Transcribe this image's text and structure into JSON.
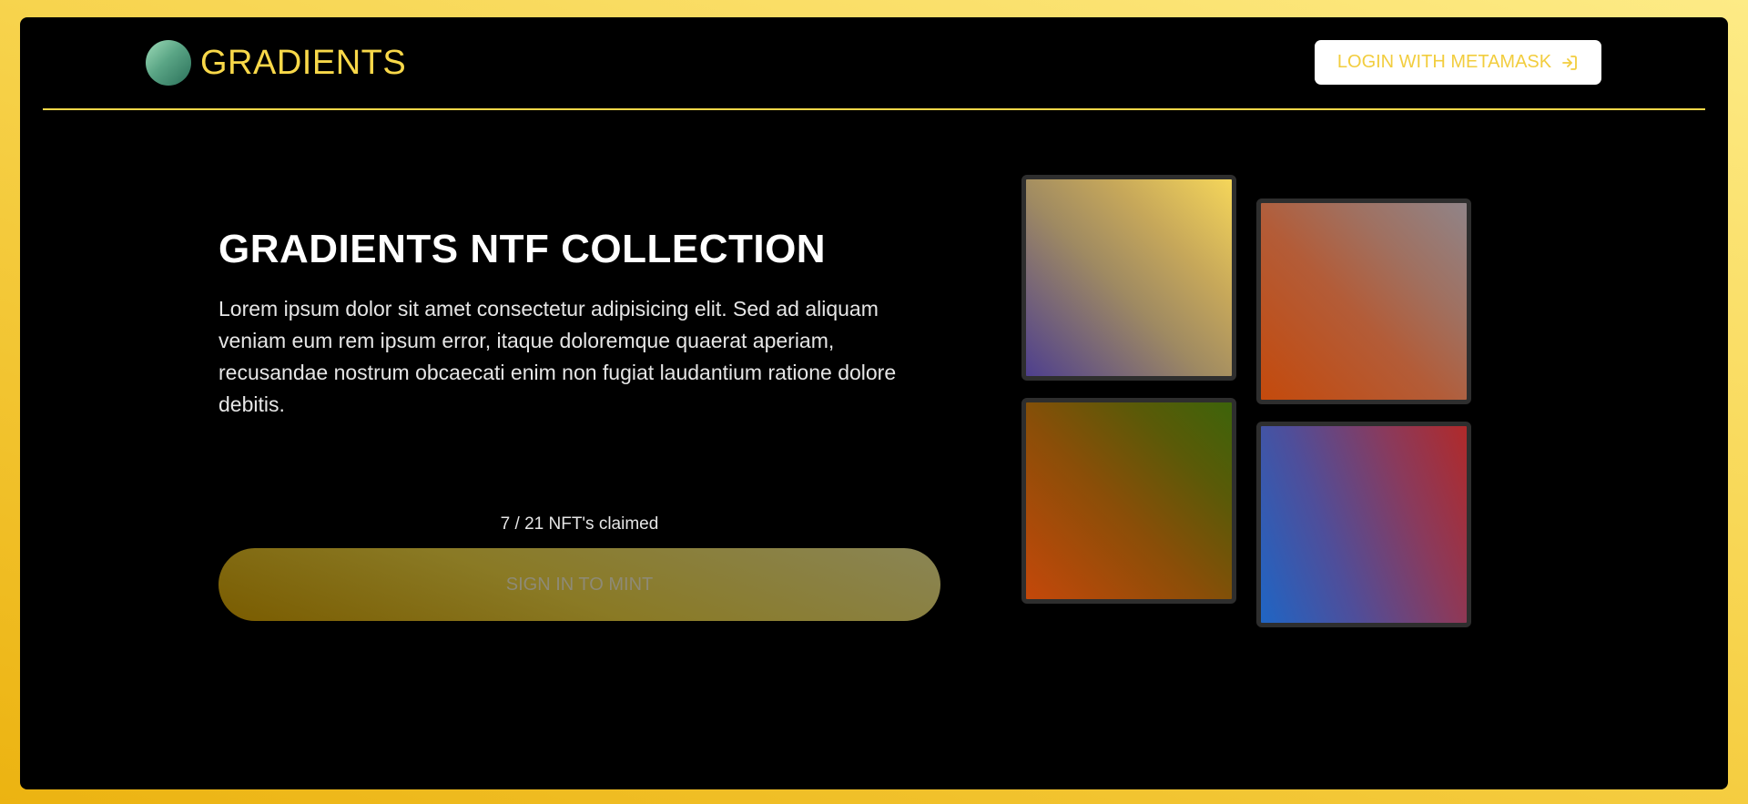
{
  "header": {
    "logo_text": "GRADIENTS",
    "login_label": "LOGIN WITH METAMASK"
  },
  "hero": {
    "title": "GRADIENTS NTF COLLECTION",
    "description": "Lorem ipsum dolor sit amet consectetur adipisicing elit. Sed ad aliquam veniam eum rem ipsum error, itaque doloremque quaerat aperiam, recusandae nostrum obcaecati enim non fugiat laudantium ratione dolore debitis."
  },
  "mint": {
    "claimed_text": "7 / 21 NFT's claimed",
    "button_label": "SIGN IN TO MINT"
  },
  "colors": {
    "accent": "#f8d849",
    "background": "#000000",
    "page_gradient": [
      "#fdeb86",
      "#ecb311"
    ]
  },
  "icons": {
    "logo": "gradient-orb-icon",
    "login": "sign-in-arrow-icon"
  },
  "gallery": {
    "tiles": [
      {
        "name": "gradient-tile-1",
        "colors": [
          "#4e3f8e",
          "#f5d65a"
        ]
      },
      {
        "name": "gradient-tile-2",
        "colors": [
          "#c44a0c",
          "#908488"
        ]
      },
      {
        "name": "gradient-tile-3",
        "colors": [
          "#c4480a",
          "#3d640a"
        ]
      },
      {
        "name": "gradient-tile-4",
        "colors": [
          "#1f65c4",
          "#b02a2a"
        ]
      }
    ]
  }
}
